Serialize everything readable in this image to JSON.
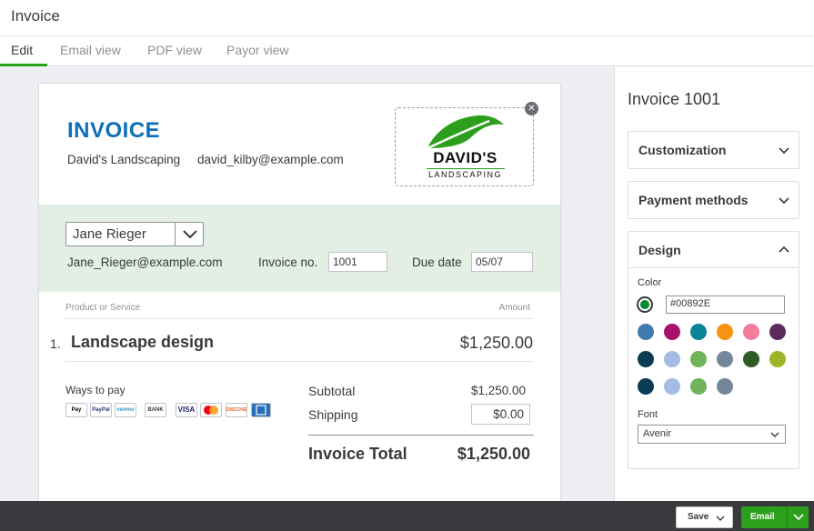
{
  "app": {
    "title": "Invoice"
  },
  "tabs": [
    {
      "label": "Edit"
    },
    {
      "label": "Email view"
    },
    {
      "label": "PDF view"
    },
    {
      "label": "Payor view"
    }
  ],
  "invoice": {
    "heading": "INVOICE",
    "business_name": "David's Landscaping",
    "business_email": "david_kilby@example.com",
    "logo": {
      "name": "DAVID'S",
      "sub": "LANDSCAPING",
      "icon": "leaf-logo"
    },
    "customer": "Jane Rieger",
    "customer_email": "Jane_Rieger@example.com",
    "invoice_no_label": "Invoice no.",
    "invoice_no": "1001",
    "due_date_label": "Due date",
    "due_date": "05/07",
    "col_product": "Product or Service",
    "col_amount": "Amount",
    "lines": [
      {
        "num": "1.",
        "name": "Landscape design",
        "amount": "$1,250.00"
      }
    ],
    "ways_to_pay_label": "Ways to pay",
    "payment_icons": [
      "Pay",
      "PayPal",
      "venmo",
      "BANK",
      "VISA",
      "",
      "DISCOVER",
      ""
    ],
    "subtotal_label": "Subtotal",
    "subtotal": "$1,250.00",
    "shipping_label": "Shipping",
    "shipping": "$0.00",
    "total_label": "Invoice Total",
    "total": "$1,250.00"
  },
  "panel": {
    "title": "Invoice 1001",
    "sections": [
      {
        "label": "Customization"
      },
      {
        "label": "Payment methods"
      },
      {
        "label": "Design"
      }
    ],
    "color_label": "Color",
    "color_hex": "#00892E",
    "swatches": [
      "#3f7bad",
      "#a8106f",
      "#098595",
      "#f7930e",
      "#f47d9b",
      "#5a2a5a",
      "#0c3b54",
      "#a4bce4",
      "#6fb35a",
      "#74879a",
      "#2e5a24",
      "#9db427",
      "#0c3b54",
      "#a4bce4",
      "#6fb35a",
      "#74879a"
    ],
    "font_label": "Font",
    "font_value": "Avenir"
  },
  "footer": {
    "save_label": "Save",
    "email_label": "Email"
  }
}
